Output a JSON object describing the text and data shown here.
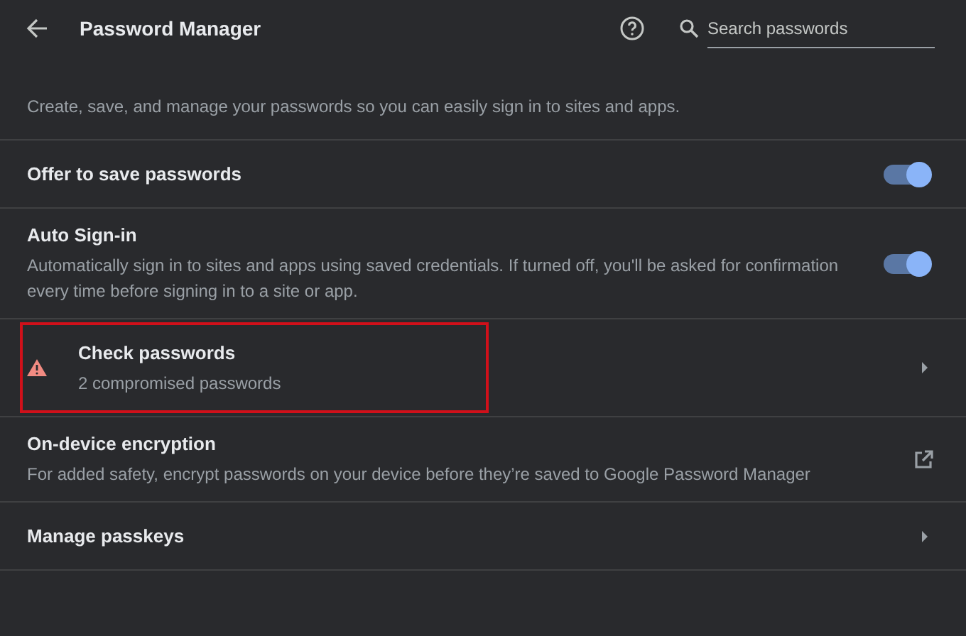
{
  "header": {
    "title": "Password Manager",
    "search": {
      "placeholder": "Search passwords"
    }
  },
  "description": "Create, save, and manage your passwords so you can easily sign in to sites and apps.",
  "rows": [
    {
      "kind": "toggle",
      "title": "Offer to save passwords",
      "on": true
    },
    {
      "kind": "toggle",
      "title": "Auto Sign-in",
      "subtitle": "Automatically sign in to sites and apps using saved credentials. If turned off, you'll be asked for confirmation every time before signing in to a site or app.",
      "on": true
    },
    {
      "kind": "warning",
      "title": "Check passwords",
      "subtitle": "2 compromised passwords",
      "highlighted": true
    },
    {
      "kind": "external",
      "title": "On-device encryption",
      "subtitle": "For added safety, encrypt passwords on your device before they’re saved to Google Password Manager"
    },
    {
      "kind": "link",
      "title": "Manage passkeys"
    }
  ]
}
